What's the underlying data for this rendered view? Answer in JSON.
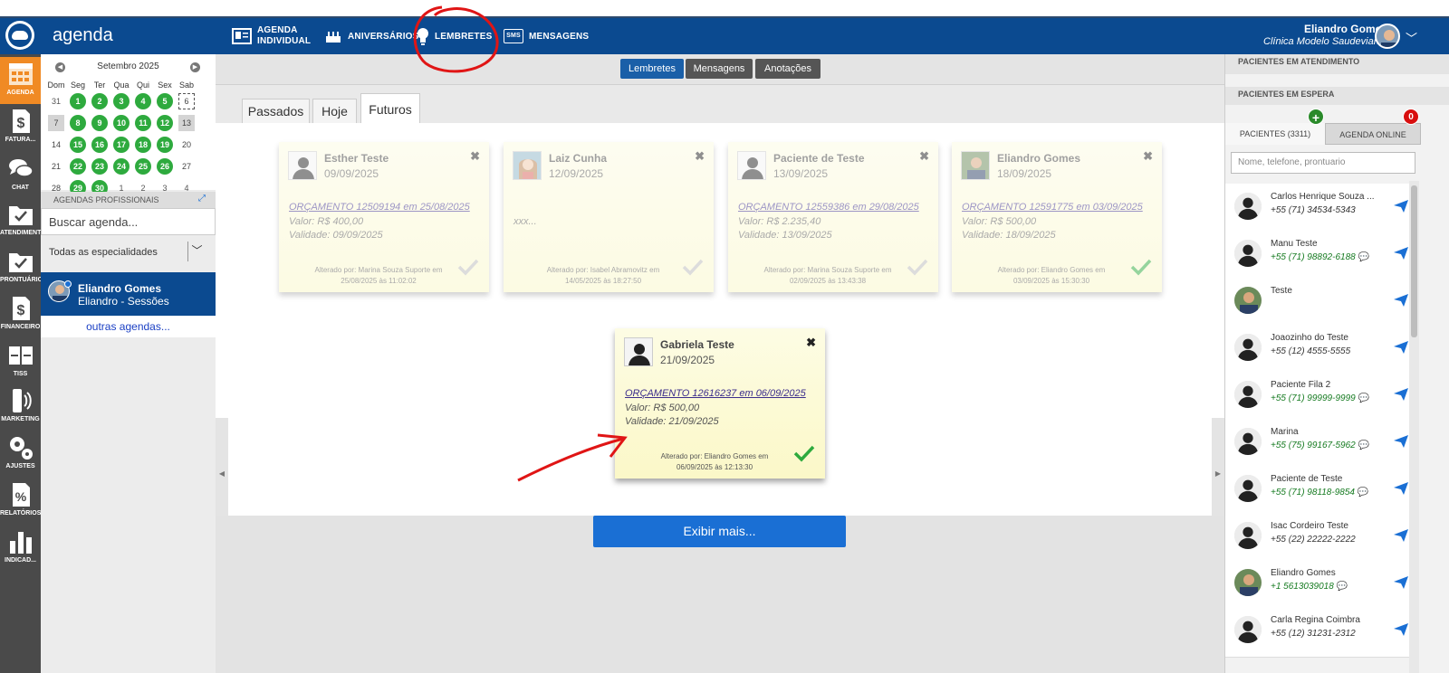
{
  "header": {
    "app_title": "agenda",
    "nav": [
      {
        "label_1": "AGENDA",
        "label_2": "INDIVIDUAL",
        "icon": "calendar-card-icon"
      },
      {
        "label_1": "ANIVERSÁRIOS",
        "icon": "cake-icon"
      },
      {
        "label_1": "LEMBRETES",
        "icon": "lightbulb-icon"
      },
      {
        "label_1": "MENSAGENS",
        "icon": "sms-icon",
        "badge": "SMS"
      }
    ],
    "user_name": "Eliandro Gomes",
    "clinic_name": "Clínica Modelo Saudevianet"
  },
  "sidebar": {
    "items": [
      {
        "label": "AGENDA",
        "icon": "calendar-icon"
      },
      {
        "label": "FATURA...",
        "icon": "dollar-doc-icon"
      },
      {
        "label": "CHAT",
        "icon": "chat-icon"
      },
      {
        "label": "ATENDIMENTO",
        "icon": "folder-check-icon"
      },
      {
        "label": "PRONTUÁRIO",
        "icon": "folder-check-icon"
      },
      {
        "label": "FINANCEIRO",
        "icon": "dollar-doc-icon"
      },
      {
        "label": "TISS",
        "icon": "cards-icon"
      },
      {
        "label": "MARKETING",
        "icon": "phone-icon"
      },
      {
        "label": "AJUSTES",
        "icon": "gears-icon"
      },
      {
        "label": "RELATÓRIOS",
        "icon": "percent-doc-icon"
      },
      {
        "label": "INDICAD...",
        "icon": "bar-chart-icon"
      }
    ]
  },
  "calendar": {
    "month_label": "Setembro 2025",
    "weekdays": [
      "Dom",
      "Seg",
      "Ter",
      "Qua",
      "Qui",
      "Sex",
      "Sab"
    ],
    "weeks": [
      [
        {
          "d": "31",
          "s": "muted"
        },
        {
          "d": "1",
          "s": "green"
        },
        {
          "d": "2",
          "s": "green"
        },
        {
          "d": "3",
          "s": "green"
        },
        {
          "d": "4",
          "s": "green"
        },
        {
          "d": "5",
          "s": "green"
        },
        {
          "d": "6",
          "s": "dotted"
        }
      ],
      [
        {
          "d": "7",
          "s": "grey"
        },
        {
          "d": "8",
          "s": "green"
        },
        {
          "d": "9",
          "s": "green"
        },
        {
          "d": "10",
          "s": "green"
        },
        {
          "d": "11",
          "s": "green"
        },
        {
          "d": "12",
          "s": "green"
        },
        {
          "d": "13",
          "s": "grey"
        }
      ],
      [
        {
          "d": "14",
          "s": "plain"
        },
        {
          "d": "15",
          "s": "green"
        },
        {
          "d": "16",
          "s": "green"
        },
        {
          "d": "17",
          "s": "green"
        },
        {
          "d": "18",
          "s": "green"
        },
        {
          "d": "19",
          "s": "green"
        },
        {
          "d": "20",
          "s": "plain"
        }
      ],
      [
        {
          "d": "21",
          "s": "plain"
        },
        {
          "d": "22",
          "s": "green"
        },
        {
          "d": "23",
          "s": "green"
        },
        {
          "d": "24",
          "s": "green"
        },
        {
          "d": "25",
          "s": "green"
        },
        {
          "d": "26",
          "s": "green"
        },
        {
          "d": "27",
          "s": "plain"
        }
      ],
      [
        {
          "d": "28",
          "s": "plain"
        },
        {
          "d": "29",
          "s": "green"
        },
        {
          "d": "30",
          "s": "green"
        },
        {
          "d": "1",
          "s": "muted"
        },
        {
          "d": "2",
          "s": "muted"
        },
        {
          "d": "3",
          "s": "muted"
        },
        {
          "d": "4",
          "s": "muted"
        }
      ]
    ]
  },
  "agendas": {
    "heading": "AGENDAS PROFISSIONAIS",
    "search_placeholder": "Buscar agenda...",
    "specialty": "Todas as especialidades",
    "selected_name": "Eliandro Gomes",
    "selected_sub": "Eliandro - Sessões",
    "other_link": "outras agendas..."
  },
  "main": {
    "top_buttons": [
      "Lembretes",
      "Mensagens",
      "Anotações"
    ],
    "tabs": [
      "Passados",
      "Hoje",
      "Futuros"
    ],
    "active_tab": "Futuros",
    "show_more": "Exibir mais...",
    "cards": [
      {
        "name": "Esther Teste",
        "date": "09/09/2025",
        "line1": "ORÇAMENTO 12509194 em 25/08/2025",
        "line2": "Valor: R$ 400,00",
        "line3": "Validade: 09/09/2025",
        "by1": "Alterado por: Marina Souza Suporte em",
        "by2": "25/08/2025 às 11:02:02",
        "avatar": "silhouette",
        "checked": false
      },
      {
        "name": "Laiz Cunha",
        "date": "12/09/2025",
        "line1": "",
        "line2": "xxx...",
        "line3": "",
        "by1": "Alterado por: Isabel Abramovitz em",
        "by2": "14/05/2025 às 18:27:50",
        "avatar": "photo-woman",
        "checked": false
      },
      {
        "name": "Paciente de Teste",
        "date": "13/09/2025",
        "line1": "ORÇAMENTO 12559386 em 29/08/2025",
        "line2": "Valor: R$ 2.235,40",
        "line3": "Validade: 13/09/2025",
        "by1": "Alterado por: Marina Souza Suporte em",
        "by2": "02/09/2025 às 13:43:38",
        "avatar": "silhouette",
        "checked": false
      },
      {
        "name": "Eliandro Gomes",
        "date": "18/09/2025",
        "line1": "ORÇAMENTO 12591775 em 03/09/2025",
        "line2": "Valor: R$ 500,00",
        "line3": "Validade: 18/09/2025",
        "by1": "Alterado por: Eliandro Gomes em",
        "by2": "03/09/2025 às 15:30:30",
        "avatar": "photo-man",
        "checked": true
      },
      {
        "name": "Gabriela Teste",
        "date": "21/09/2025",
        "line1": "ORÇAMENTO 12616237 em 06/09/2025",
        "line2": "Valor: R$ 500,00",
        "line3": "Validade: 21/09/2025",
        "by1": "Alterado por: Eliandro Gomes em",
        "by2": "06/09/2025 às 12:13:30",
        "avatar": "silhouette",
        "checked": true
      }
    ]
  },
  "right_panel": {
    "in_service": "PACIENTES EM ATENDIMENTO",
    "waiting": "PACIENTES EM ESPERA",
    "tab_patients": "PACIENTES (3311)",
    "tab_online": "AGENDA ONLINE",
    "online_badge": "0",
    "search_placeholder": "Nome, telefone, prontuario",
    "patients": [
      {
        "name": "Carlos Henrique Souza ...",
        "phone": "+55 (71) 34534-5343",
        "whatsapp": false,
        "avatar": "silhouette"
      },
      {
        "name": "Manu Teste",
        "phone": "+55 (71) 98892-6188",
        "whatsapp": true,
        "avatar": "silhouette"
      },
      {
        "name": "Teste",
        "phone": "",
        "whatsapp": false,
        "avatar": "photo"
      },
      {
        "name": "Joaozinho do Teste",
        "phone": "+55 (12) 4555-5555",
        "whatsapp": false,
        "avatar": "silhouette"
      },
      {
        "name": "Paciente Fila 2",
        "phone": "+55 (71) 99999-9999",
        "whatsapp": true,
        "avatar": "silhouette"
      },
      {
        "name": "Marina",
        "phone": "+55 (75) 99167-5962",
        "whatsapp": true,
        "avatar": "silhouette"
      },
      {
        "name": "Paciente de Teste",
        "phone": "+55 (71) 98118-9854",
        "whatsapp": true,
        "avatar": "silhouette"
      },
      {
        "name": "Isac Cordeiro Teste",
        "phone": "+55 (22) 22222-2222",
        "whatsapp": false,
        "avatar": "silhouette"
      },
      {
        "name": "Eliandro Gomes",
        "phone": "+1 5613039018",
        "whatsapp": true,
        "avatar": "photo"
      },
      {
        "name": "Carla Regina Coimbra",
        "phone": "+55 (12) 31231-2312",
        "whatsapp": false,
        "avatar": "silhouette"
      }
    ]
  },
  "colors": {
    "brand_blue": "#0b4a90",
    "sidebar_active": "#f08a24",
    "calendar_green": "#2eaa3e",
    "card_yellow": "#fbf8c8",
    "annotation_red": "#e01515"
  }
}
